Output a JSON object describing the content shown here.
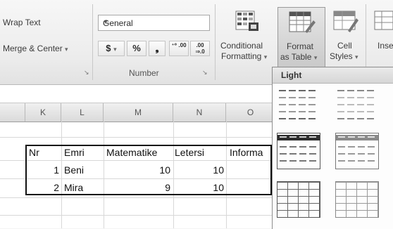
{
  "ribbon": {
    "alignment": {
      "wrap_text": "Wrap Text",
      "merge_center": "Merge & Center",
      "merge_arrow": "▾",
      "launcher": "↘"
    },
    "number": {
      "format_value": "General",
      "dropdown_arrow": "▼",
      "currency": "$",
      "currency_arrow": "▾",
      "percent": "%",
      "comma": "❟",
      "increase_decimal": "⁺⁰ .00",
      "decrease_decimal": ".00 ⇒.0",
      "group_label": "Number",
      "launcher": "↘"
    },
    "styles": {
      "conditional_line1": "Conditional",
      "conditional_line2": "Formatting",
      "conditional_arrow": "▾",
      "format_line1": "Format",
      "format_line2": "as Table",
      "format_arrow": "▾",
      "cell_line1": "Cell",
      "cell_line2": "Styles",
      "cell_arrow": "▾"
    },
    "insert_label": "Inse"
  },
  "sheet": {
    "columns": [
      "K",
      "L",
      "M",
      "N",
      "O"
    ],
    "header_row": [
      "Nr",
      "Emri",
      "Matematike",
      "Letersi",
      "Informa"
    ],
    "rows": [
      {
        "nr": "1",
        "emri": "Beni",
        "mat": "10",
        "let": "10"
      },
      {
        "nr": "2",
        "emri": "Mira",
        "mat": "9",
        "let": "10"
      }
    ]
  },
  "gallery": {
    "section_label": "Light"
  },
  "colors": {
    "ribbon_bg": "#ececec",
    "active_button": "#d2d2d2",
    "table_border": "#111111"
  }
}
